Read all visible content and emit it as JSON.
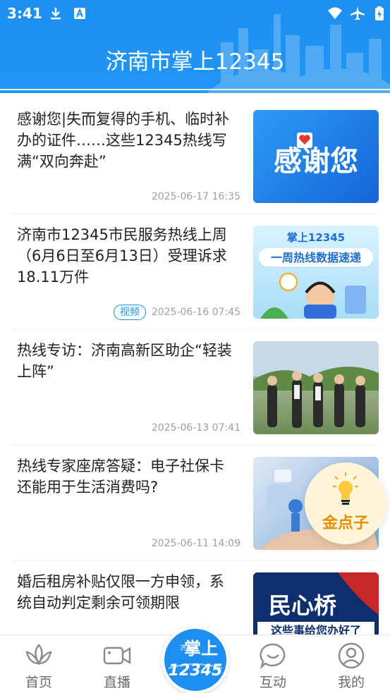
{
  "status_bar": {
    "time": "3:41"
  },
  "header": {
    "title": "济南市掌上12345"
  },
  "news": [
    {
      "title": "感谢您|失而复得的手机、临时补办的证件……这些12345热线写满“双向奔赴”",
      "date": "2025-06-17 16:35",
      "tag": "",
      "thumb_text": "感谢您",
      "thumb_color": "#1e7fe8"
    },
    {
      "title": "济南市12345市民服务热线上周（6月6日至6月13日）受理诉求18.11万件",
      "date": "2025-06-16 07:45",
      "tag": "视频",
      "thumb_text_top": "掌上12345",
      "thumb_text_main": "一周热线数据速递",
      "thumb_color": "#bfe9ff"
    },
    {
      "title": "热线专访：济南高新区助企“轻装上阵”",
      "date": "2025-06-13 07:41",
      "tag": "",
      "thumb_color": "#8aa27a"
    },
    {
      "title": "热线专家座席答疑：电子社保卡还能用于生活消费吗?",
      "date": "2025-06-11 14:09",
      "tag": "",
      "thumb_color": "#9ec3e6"
    },
    {
      "title": "婚后租房补贴仅限一方申领，系统自动判定剩余可领期限",
      "date": "",
      "tag": "",
      "thumb_text": "民心桥",
      "thumb_sub": "这些事给您办好了",
      "thumb_color": "#0d2f6e"
    }
  ],
  "floating": {
    "label": "金点子"
  },
  "nav": {
    "home": "首页",
    "live": "直播",
    "center_line1": "济南市",
    "center_line2": "掌上",
    "center_line3": "12345",
    "interact": "互动",
    "mine": "我的"
  }
}
